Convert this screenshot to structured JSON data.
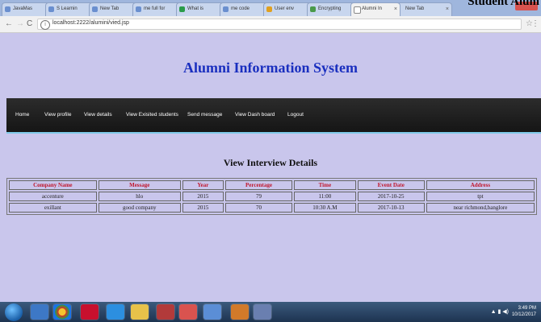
{
  "browser": {
    "tabs": [
      {
        "label": "JavaMas"
      },
      {
        "label": "S Learnin"
      },
      {
        "label": "New Tab"
      },
      {
        "label": "me full for"
      },
      {
        "label": "What is"
      },
      {
        "label": "me code"
      },
      {
        "label": "User env"
      },
      {
        "label": "Encrypting"
      },
      {
        "label": "Alumni In"
      },
      {
        "label": "New Tab"
      }
    ],
    "active_tab_index": 8,
    "url": "localhost:2222/alumini/vied.jsp",
    "watermark": "Student Alum"
  },
  "header": {
    "title": "Alumni Information System"
  },
  "nav": {
    "items": [
      "Home",
      "View profile",
      "View details",
      "View Exisited students",
      "Send message",
      "View Dash board",
      "Logout"
    ]
  },
  "section": {
    "title": "View Interview Details"
  },
  "table": {
    "columns": [
      "Company Name",
      "Message",
      "Year",
      "Percentage",
      "Time",
      "Event Date",
      "Address"
    ],
    "rows": [
      [
        "accenture",
        "hlo",
        "2015",
        "79",
        "11:00",
        "2017-10-25",
        "tpt"
      ],
      [
        "exillant",
        "good company",
        "2015",
        "70",
        "10:30 A.M",
        "2017-10-13",
        "near richmond,banglore"
      ]
    ]
  },
  "taskbar": {
    "time": "3:49 PM",
    "date": "10/12/2017"
  }
}
